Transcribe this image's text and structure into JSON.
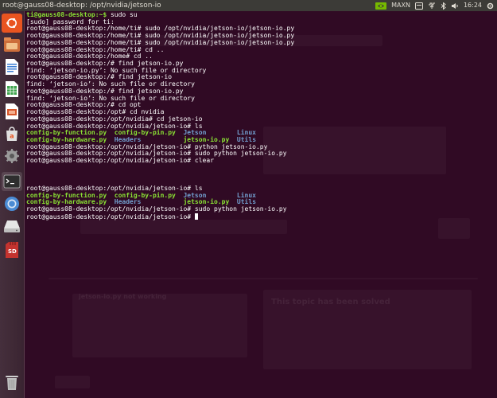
{
  "window": {
    "title": "root@gauss08-desktop: /opt/nvidia/jetson-io"
  },
  "tray": {
    "nvidia_mode": "MAXN",
    "time": "16:24"
  },
  "launcher": {
    "items": [
      {
        "name": "ubuntu-dash-icon",
        "color": "#e95420"
      },
      {
        "name": "files-icon",
        "color": "#cc6e3b"
      },
      {
        "name": "libreoffice-writer-icon",
        "color": "#3b7ed3"
      },
      {
        "name": "libreoffice-calc-icon",
        "color": "#3fa34d"
      },
      {
        "name": "libreoffice-impress-icon",
        "color": "#d6572c"
      },
      {
        "name": "software-center-icon",
        "color": "#e0e0e0"
      },
      {
        "name": "settings-icon",
        "color": "#9a9a9a"
      },
      {
        "name": "terminal-icon",
        "color": "#2e2e2e"
      },
      {
        "name": "chromium-icon",
        "color": "#4a8bd4"
      },
      {
        "name": "drive-icon",
        "color": "#cfcfcf"
      },
      {
        "name": "sd-card-icon",
        "color": "#c4332f"
      },
      {
        "name": "trash-icon",
        "color": "#bdbdbd"
      }
    ],
    "sd_label": "SD"
  },
  "background_page": {
    "heading": "This topic has been solved",
    "reply_title": "jetson-io.py not working"
  },
  "terminal": {
    "lines": [
      [
        {
          "t": "ti@gauss08-desktop:~$ ",
          "c": "g"
        },
        {
          "t": "sudo su",
          "c": ""
        }
      ],
      [
        {
          "t": "[sudo] password for ti:",
          "c": ""
        }
      ],
      [
        {
          "t": "root@gauss08-desktop:/home/ti# sudo /opt/nvidia/jetson-io/jetson-io.py",
          "c": ""
        }
      ],
      [
        {
          "t": "root@gauss08-desktop:/home/ti# sudo /opt/nvidia/jetson-io/jetson-io.py",
          "c": ""
        }
      ],
      [
        {
          "t": "root@gauss08-desktop:/home/ti# sudo /opt/nvidia/jetson-io/jetson-io.py",
          "c": ""
        }
      ],
      [
        {
          "t": "root@gauss08-desktop:/home/ti# cd ..",
          "c": ""
        }
      ],
      [
        {
          "t": "root@gauss08-desktop:/home# cd ..",
          "c": ""
        }
      ],
      [
        {
          "t": "root@gauss08-desktop:/# find jetson-io.py",
          "c": ""
        }
      ],
      [
        {
          "t": "find: ‘jetson-io.py’: No such file or directory",
          "c": ""
        }
      ],
      [
        {
          "t": "root@gauss08-desktop:/# find jetson-io",
          "c": ""
        }
      ],
      [
        {
          "t": "find: ‘jetson-io’: No such file or directory",
          "c": ""
        }
      ],
      [
        {
          "t": "root@gauss08-desktop:/# find jetson-io.py",
          "c": ""
        }
      ],
      [
        {
          "t": "find: ‘jetson-io’: No such file or directory",
          "c": ""
        }
      ],
      [
        {
          "t": "root@gauss08-desktop:/# cd opt",
          "c": ""
        }
      ],
      [
        {
          "t": "root@gauss08-desktop:/opt# cd nvidia",
          "c": ""
        }
      ],
      [
        {
          "t": "root@gauss08-desktop:/opt/nvidia# cd jetson-io",
          "c": ""
        }
      ],
      [
        {
          "t": "root@gauss08-desktop:/opt/nvidia/jetson-io# ls",
          "c": ""
        }
      ],
      [
        {
          "t": "config-by-function.py  config-by-pin.py  ",
          "c": "g"
        },
        {
          "t": "Jetson        Linux",
          "c": "b"
        }
      ],
      [
        {
          "t": "config-by-hardware.py  ",
          "c": "g"
        },
        {
          "t": "Headers           ",
          "c": "b"
        },
        {
          "t": "jetson-io.py  ",
          "c": "g"
        },
        {
          "t": "Utils",
          "c": "b"
        }
      ],
      [
        {
          "t": "root@gauss08-desktop:/opt/nvidia/jetson-io# python jetson-io.py",
          "c": ""
        }
      ],
      [
        {
          "t": "root@gauss08-desktop:/opt/nvidia/jetson-io# sudo python jetson-io.py",
          "c": ""
        }
      ],
      [
        {
          "t": "root@gauss08-desktop:/opt/nvidia/jetson-io# clear",
          "c": ""
        }
      ],
      [],
      [],
      [],
      [
        {
          "t": "root@gauss08-desktop:/opt/nvidia/jetson-io# ls",
          "c": ""
        }
      ],
      [
        {
          "t": "config-by-function.py  config-by-pin.py  ",
          "c": "g"
        },
        {
          "t": "Jetson        Linux",
          "c": "b"
        }
      ],
      [
        {
          "t": "config-by-hardware.py  ",
          "c": "g"
        },
        {
          "t": "Headers           ",
          "c": "b"
        },
        {
          "t": "jetson-io.py  ",
          "c": "g"
        },
        {
          "t": "Utils",
          "c": "b"
        }
      ],
      [
        {
          "t": "root@gauss08-desktop:/opt/nvidia/jetson-io# sudo python jetson-io.py",
          "c": ""
        }
      ],
      [
        {
          "t": "root@gauss08-desktop:/opt/nvidia/jetson-io# ",
          "c": ""
        },
        {
          "cursor": true
        }
      ]
    ]
  },
  "colors": {
    "terminal_bg": "#300a24",
    "prompt_green": "#8ae234",
    "dir_blue": "#729fcf",
    "text": "#ffffff",
    "topbar_bg": "#3c3b37"
  }
}
